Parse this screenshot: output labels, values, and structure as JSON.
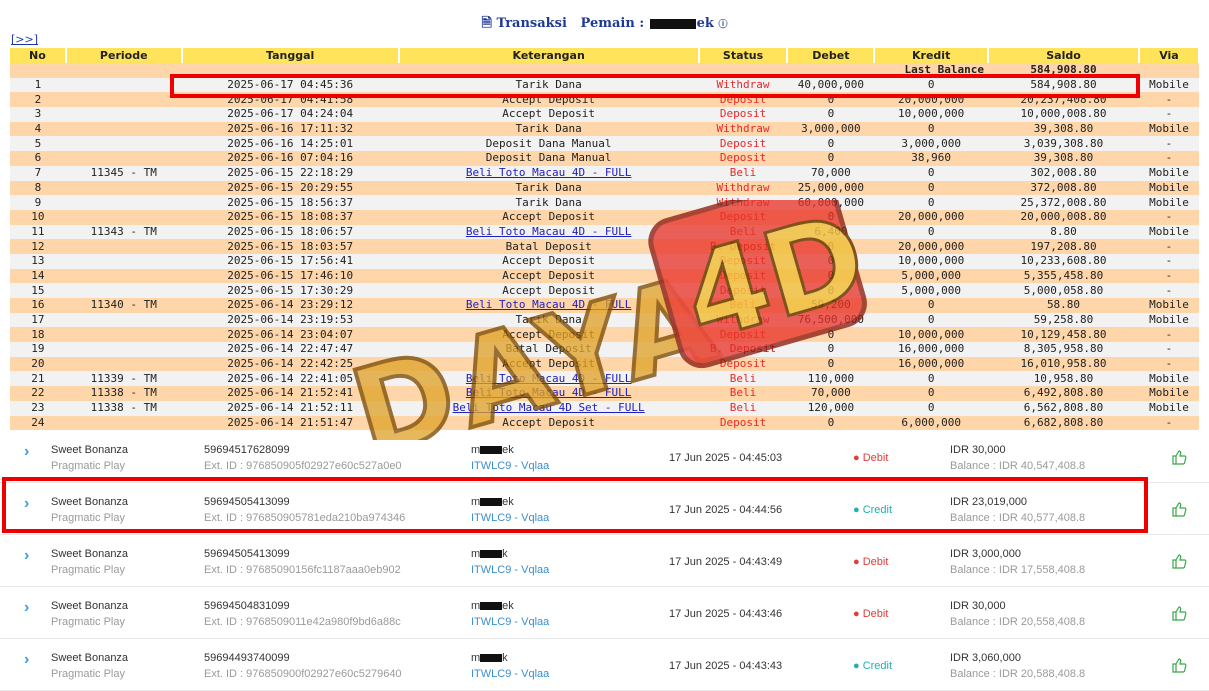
{
  "header": {
    "title": "Transaksi",
    "pemain_label": "Pemain :",
    "player_suffix": "ek",
    "expand_link": "[>>]"
  },
  "table": {
    "columns": [
      "No",
      "Periode",
      "Tanggal",
      "Keterangan",
      "Status",
      "Debet",
      "Kredit",
      "Saldo",
      "Via"
    ],
    "last_balance_label": "Last Balance",
    "last_balance_value": "584,908.80",
    "rows": [
      {
        "no": "1",
        "periode": "",
        "tanggal": "2025-06-17 04:45:36",
        "ket": "Tarik Dana",
        "link": false,
        "status": "Withdraw",
        "debet": "40,000,000",
        "kredit": "0",
        "saldo": "584,908.80",
        "via": "Mobile"
      },
      {
        "no": "2",
        "periode": "",
        "tanggal": "2025-06-17 04:41:58",
        "ket": "Accept Deposit",
        "link": false,
        "status": "Deposit",
        "debet": "0",
        "kredit": "20,000,000",
        "saldo": "20,237,408.80",
        "via": "-"
      },
      {
        "no": "3",
        "periode": "",
        "tanggal": "2025-06-17 04:24:04",
        "ket": "Accept Deposit",
        "link": false,
        "status": "Deposit",
        "debet": "0",
        "kredit": "10,000,000",
        "saldo": "10,000,008.80",
        "via": "-"
      },
      {
        "no": "4",
        "periode": "",
        "tanggal": "2025-06-16 17:11:32",
        "ket": "Tarik Dana",
        "link": false,
        "status": "Withdraw",
        "debet": "3,000,000",
        "kredit": "0",
        "saldo": "39,308.80",
        "via": "Mobile"
      },
      {
        "no": "5",
        "periode": "",
        "tanggal": "2025-06-16 14:25:01",
        "ket": "Deposit Dana Manual",
        "link": false,
        "status": "Deposit",
        "debet": "0",
        "kredit": "3,000,000",
        "saldo": "3,039,308.80",
        "via": "-"
      },
      {
        "no": "6",
        "periode": "",
        "tanggal": "2025-06-16 07:04:16",
        "ket": "Deposit Dana Manual",
        "link": false,
        "status": "Deposit",
        "debet": "0",
        "kredit": "38,960",
        "saldo": "39,308.80",
        "via": "-"
      },
      {
        "no": "7",
        "periode": "11345 - TM",
        "tanggal": "2025-06-15 22:18:29",
        "ket": "Beli Toto Macau 4D - FULL",
        "link": true,
        "status": "Beli",
        "debet": "70,000",
        "kredit": "0",
        "saldo": "302,008.80",
        "via": "Mobile"
      },
      {
        "no": "8",
        "periode": "",
        "tanggal": "2025-06-15 20:29:55",
        "ket": "Tarik Dana",
        "link": false,
        "status": "Withdraw",
        "debet": "25,000,000",
        "kredit": "0",
        "saldo": "372,008.80",
        "via": "Mobile"
      },
      {
        "no": "9",
        "periode": "",
        "tanggal": "2025-06-15 18:56:37",
        "ket": "Tarik Dana",
        "link": false,
        "status": "Withdraw",
        "debet": "60,000,000",
        "kredit": "0",
        "saldo": "25,372,008.80",
        "via": "Mobile"
      },
      {
        "no": "10",
        "periode": "",
        "tanggal": "2025-06-15 18:08:37",
        "ket": "Accept Deposit",
        "link": false,
        "status": "Deposit",
        "debet": "0",
        "kredit": "20,000,000",
        "saldo": "20,000,008.80",
        "via": "-"
      },
      {
        "no": "11",
        "periode": "11343 - TM",
        "tanggal": "2025-06-15 18:06:57",
        "ket": "Beli Toto Macau 4D - FULL",
        "link": true,
        "status": "Beli",
        "debet": "6,400",
        "kredit": "0",
        "saldo": "8.80",
        "via": "Mobile"
      },
      {
        "no": "12",
        "periode": "",
        "tanggal": "2025-06-15 18:03:57",
        "ket": "Batal Deposit",
        "link": false,
        "status": "B. Deposit",
        "debet": "0",
        "kredit": "20,000,000",
        "saldo": "197,208.80",
        "via": "-"
      },
      {
        "no": "13",
        "periode": "",
        "tanggal": "2025-06-15 17:56:41",
        "ket": "Accept Deposit",
        "link": false,
        "status": "Deposit",
        "debet": "0",
        "kredit": "10,000,000",
        "saldo": "10,233,608.80",
        "via": "-"
      },
      {
        "no": "14",
        "periode": "",
        "tanggal": "2025-06-15 17:46:10",
        "ket": "Accept Deposit",
        "link": false,
        "status": "Deposit",
        "debet": "0",
        "kredit": "5,000,000",
        "saldo": "5,355,458.80",
        "via": "-"
      },
      {
        "no": "15",
        "periode": "",
        "tanggal": "2025-06-15 17:30:29",
        "ket": "Accept Deposit",
        "link": false,
        "status": "Deposit",
        "debet": "0",
        "kredit": "5,000,000",
        "saldo": "5,000,058.80",
        "via": "-"
      },
      {
        "no": "16",
        "periode": "11340 - TM",
        "tanggal": "2025-06-14 23:29:12",
        "ket": "Beli Toto Macau 4D - FULL",
        "link": true,
        "status": "Beli",
        "debet": "59,200",
        "kredit": "0",
        "saldo": "58.80",
        "via": "Mobile"
      },
      {
        "no": "17",
        "periode": "",
        "tanggal": "2025-06-14 23:19:53",
        "ket": "Tarik Dana",
        "link": false,
        "status": "Withdraw",
        "debet": "76,500,000",
        "kredit": "0",
        "saldo": "59,258.80",
        "via": "Mobile"
      },
      {
        "no": "18",
        "periode": "",
        "tanggal": "2025-06-14 23:04:07",
        "ket": "Accept Deposit",
        "link": false,
        "status": "Deposit",
        "debet": "0",
        "kredit": "10,000,000",
        "saldo": "10,129,458.80",
        "via": "-"
      },
      {
        "no": "19",
        "periode": "",
        "tanggal": "2025-06-14 22:47:47",
        "ket": "Batal Deposit",
        "link": false,
        "status": "B. Deposit",
        "debet": "0",
        "kredit": "16,000,000",
        "saldo": "8,305,958.80",
        "via": "-"
      },
      {
        "no": "20",
        "periode": "",
        "tanggal": "2025-06-14 22:42:25",
        "ket": "Accept Deposit",
        "link": false,
        "status": "Deposit",
        "debet": "0",
        "kredit": "16,000,000",
        "saldo": "16,010,958.80",
        "via": "-"
      },
      {
        "no": "21",
        "periode": "11339 - TM",
        "tanggal": "2025-06-14 22:41:05",
        "ket": "Beli Toto Macau 4D - FULL",
        "link": true,
        "status": "Beli",
        "debet": "110,000",
        "kredit": "0",
        "saldo": "10,958.80",
        "via": "Mobile"
      },
      {
        "no": "22",
        "periode": "11338 - TM",
        "tanggal": "2025-06-14 21:52:41",
        "ket": "Beli Toto Macau 4D - FULL",
        "link": true,
        "status": "Beli",
        "debet": "70,000",
        "kredit": "0",
        "saldo": "6,492,808.80",
        "via": "Mobile"
      },
      {
        "no": "23",
        "periode": "11338 - TM",
        "tanggal": "2025-06-14 21:52:11",
        "ket": "Beli Toto Macau 4D Set - FULL",
        "link": true,
        "status": "Beli",
        "debet": "120,000",
        "kredit": "0",
        "saldo": "6,562,808.80",
        "via": "Mobile"
      },
      {
        "no": "24",
        "periode": "",
        "tanggal": "2025-06-14 21:51:47",
        "ket": "Accept Deposit",
        "link": false,
        "status": "Deposit",
        "debet": "0",
        "kredit": "6,000,000",
        "saldo": "6,682,808.80",
        "via": "-"
      }
    ]
  },
  "watermark": {
    "text": "DAYA 4D"
  },
  "game_log": [
    {
      "game": "Sweet Bonanza",
      "provider": "Pragmatic Play",
      "tid": "59694517628099",
      "ext": "Ext. ID : 976850905f02927e60c527a0e0",
      "user_prefix": "m",
      "user_suffix": "ek",
      "agent": "ITWLC9 - Vqlaa",
      "time": "17 Jun 2025 - 04:45:03",
      "type": "Debit",
      "amount": "IDR 30,000",
      "balance": "Balance : IDR 40,547,408.8"
    },
    {
      "game": "Sweet Bonanza",
      "provider": "Pragmatic Play",
      "tid": "59694505413099",
      "ext": "Ext. ID : 976850905781eda210ba974346",
      "user_prefix": "m",
      "user_suffix": "ek",
      "agent": "ITWLC9 - Vqlaa",
      "time": "17 Jun 2025 - 04:44:56",
      "type": "Credit",
      "amount": "IDR 23,019,000",
      "balance": "Balance : IDR 40,577,408.8"
    },
    {
      "game": "Sweet Bonanza",
      "provider": "Pragmatic Play",
      "tid": "59694505413099",
      "ext": "Ext. ID : 97685090156fc1187aaa0eb902",
      "user_prefix": "m",
      "user_suffix": "k",
      "agent": "ITWLC9 - Vqlaa",
      "time": "17 Jun 2025 - 04:43:49",
      "type": "Debit",
      "amount": "IDR 3,000,000",
      "balance": "Balance : IDR 17,558,408.8"
    },
    {
      "game": "Sweet Bonanza",
      "provider": "Pragmatic Play",
      "tid": "59694504831099",
      "ext": "Ext. ID : 9768509011e42a980f9bd6a88c",
      "user_prefix": "m",
      "user_suffix": "ek",
      "agent": "ITWLC9 - Vqlaa",
      "time": "17 Jun 2025 - 04:43:46",
      "type": "Debit",
      "amount": "IDR 30,000",
      "balance": "Balance : IDR 20,558,408.8"
    },
    {
      "game": "Sweet Bonanza",
      "provider": "Pragmatic Play",
      "tid": "59694493740099",
      "ext": "Ext. ID : 976850900f02927e60c5279640",
      "user_prefix": "m",
      "user_suffix": "k",
      "agent": "ITWLC9 - Vqlaa",
      "time": "17 Jun 2025 - 04:43:43",
      "type": "Credit",
      "amount": "IDR 3,060,000",
      "balance": "Balance : IDR 20,588,408.8"
    }
  ]
}
